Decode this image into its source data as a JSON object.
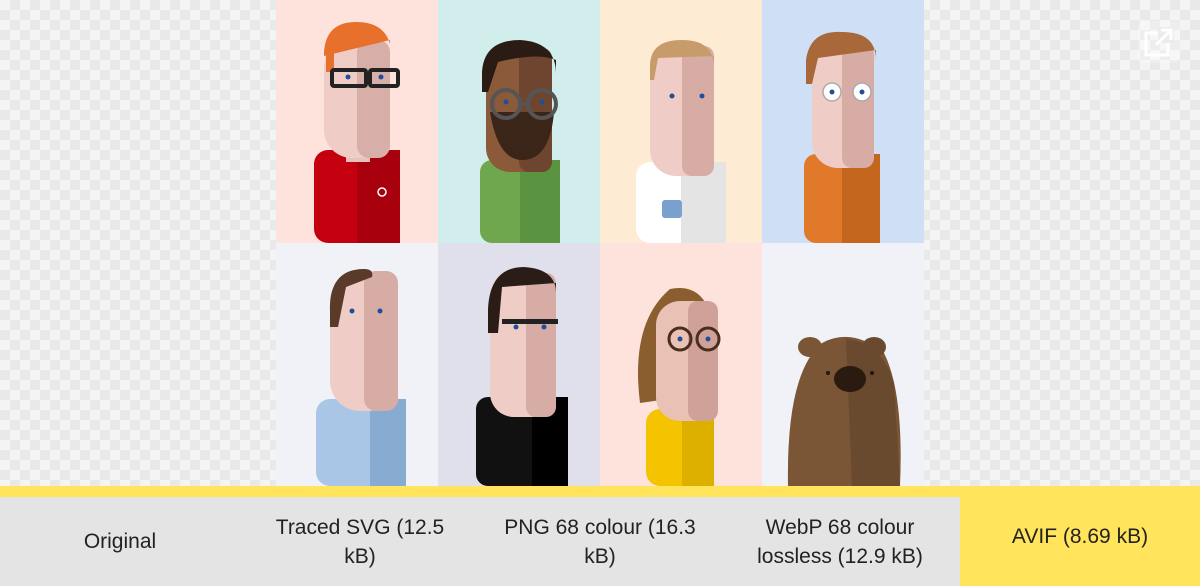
{
  "gallery": {
    "tiles": [
      {
        "name": "person-redhead-red-shirt",
        "bg": "#fde3dc"
      },
      {
        "name": "person-bearded-green-shirt",
        "bg": "#d1eeec"
      },
      {
        "name": "person-blond-white-tshirt",
        "bg": "#fdebd3"
      },
      {
        "name": "person-ginger-orange-shirt",
        "bg": "#cfe0f6"
      },
      {
        "name": "person-brown-hair-blue-shirt",
        "bg": "#f1f2f7"
      },
      {
        "name": "person-dark-hair-black-shirt",
        "bg": "#e0dfec"
      },
      {
        "name": "person-long-hair-yellow-top",
        "bg": "#fde3dc"
      },
      {
        "name": "wombat",
        "bg": "#f1f2f7"
      }
    ]
  },
  "open_button": {
    "icon": "external-link-icon"
  },
  "options": [
    {
      "label": "Original"
    },
    {
      "label": "Traced SVG (12.5 kB)"
    },
    {
      "label": "PNG 68 colour (16.3 kB)"
    },
    {
      "label": "WebP 68 colour lossless (12.9 kB)"
    },
    {
      "label": "AVIF (8.69 kB)"
    }
  ],
  "colors": {
    "accent": "#ffe45c",
    "bar_bg": "#e4e4e4"
  }
}
